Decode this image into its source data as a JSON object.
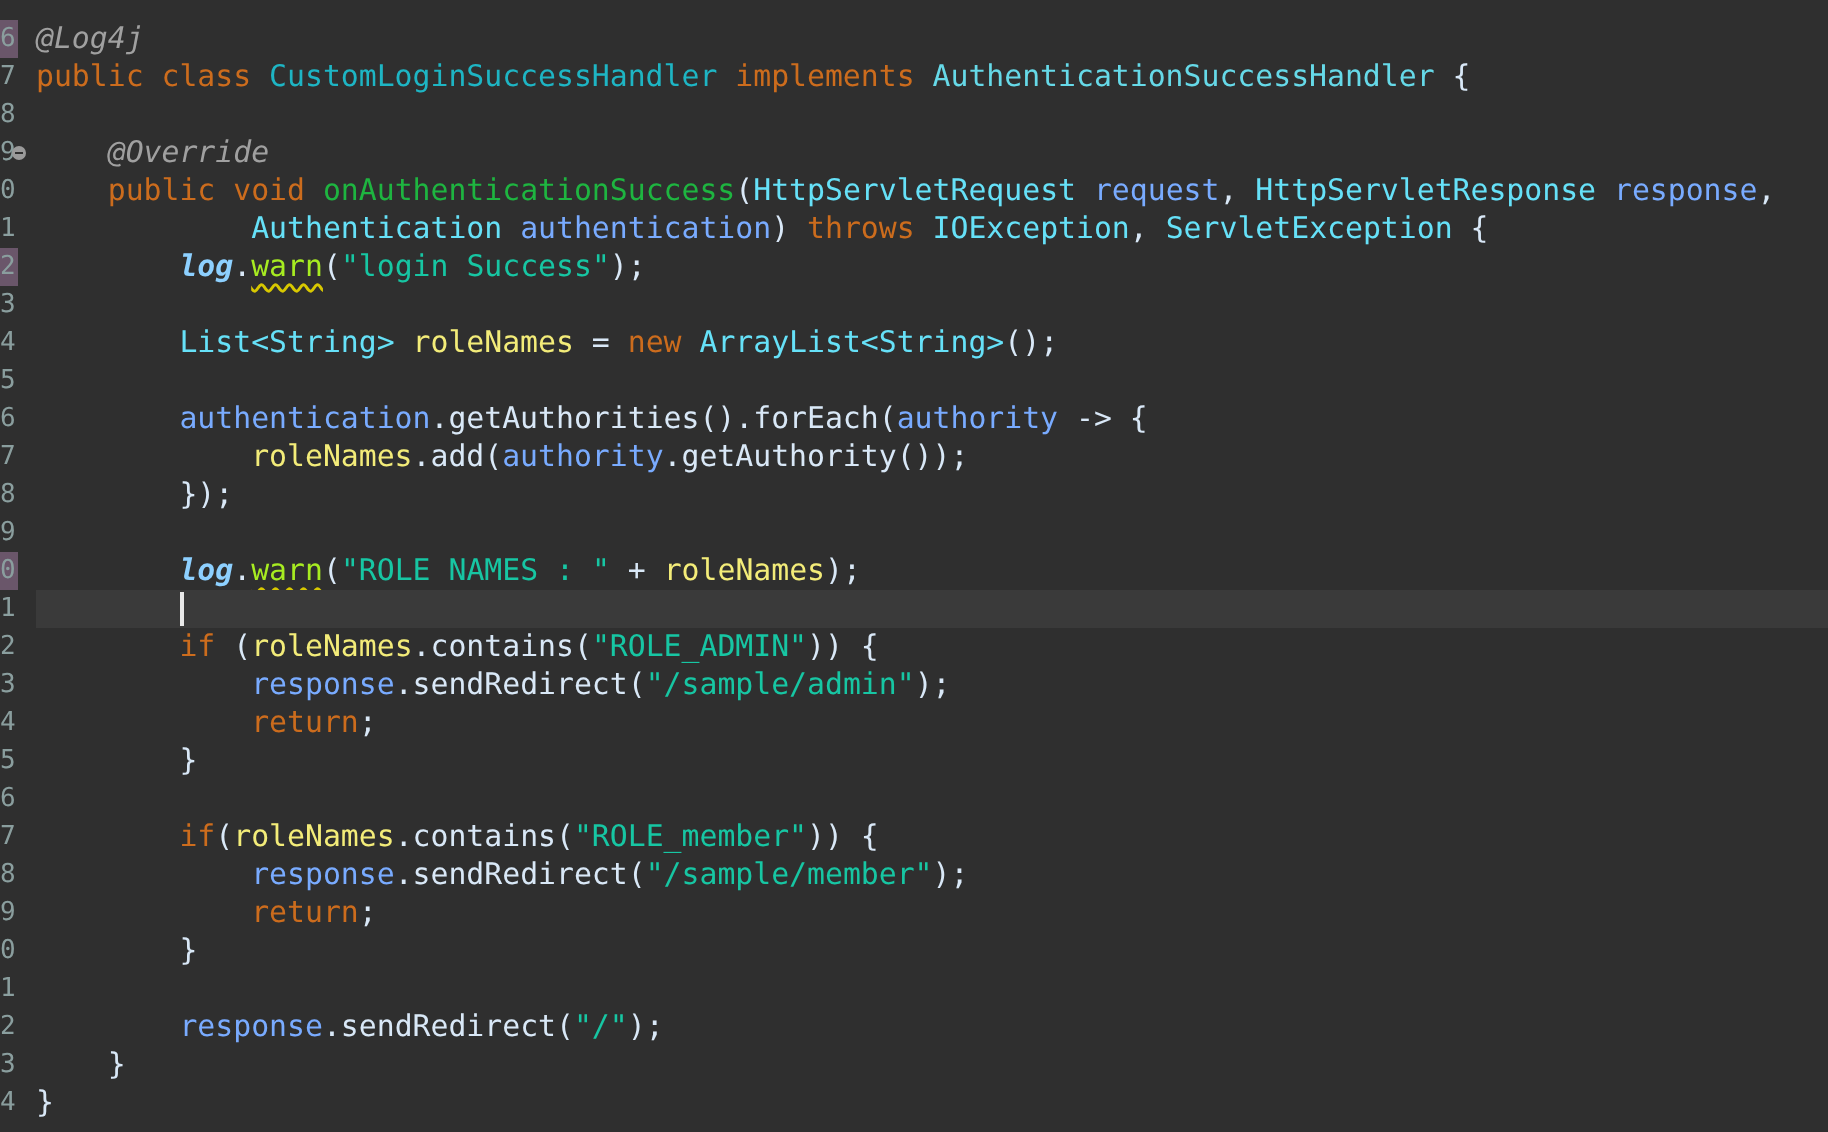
{
  "editor": {
    "lines": [
      {
        "number": "6",
        "marked": true,
        "fold": false,
        "current": false,
        "tokens": [
          {
            "kind": "annotation",
            "text": "@Log4j"
          }
        ]
      },
      {
        "number": "7",
        "marked": false,
        "fold": false,
        "current": false,
        "tokens": [
          {
            "kind": "keyword",
            "text": "public class "
          },
          {
            "kind": "class",
            "text": "CustomLoginSuccessHandler "
          },
          {
            "kind": "keyword",
            "text": "implements "
          },
          {
            "kind": "interface",
            "text": "AuthenticationSuccessHandler"
          },
          {
            "kind": "plain",
            "text": " {"
          }
        ]
      },
      {
        "number": "8",
        "marked": false,
        "fold": false,
        "current": false
      },
      {
        "number": "9",
        "marked": false,
        "fold": true,
        "current": false,
        "tokens": [
          {
            "kind": "annotation",
            "text": "    @Override"
          }
        ]
      },
      {
        "number": "0",
        "marked": false,
        "fold": false,
        "current": false,
        "tokens": [
          {
            "kind": "keyword",
            "text": "    public void "
          },
          {
            "kind": "method",
            "text": "onAuthenticationSuccess"
          },
          {
            "kind": "plain",
            "text": "("
          },
          {
            "kind": "type",
            "text": "HttpServletRequest "
          },
          {
            "kind": "param",
            "text": "request"
          },
          {
            "kind": "plain",
            "text": ", "
          },
          {
            "kind": "type",
            "text": "HttpServletResponse "
          },
          {
            "kind": "param",
            "text": "response"
          },
          {
            "kind": "plain",
            "text": ","
          }
        ]
      },
      {
        "number": "1",
        "marked": false,
        "fold": false,
        "current": false,
        "tokens": [
          {
            "kind": "type",
            "text": "            Authentication "
          },
          {
            "kind": "param",
            "text": "authentication"
          },
          {
            "kind": "plain",
            "text": ") "
          },
          {
            "kind": "keyword",
            "text": "throws "
          },
          {
            "kind": "type",
            "text": "IOException"
          },
          {
            "kind": "plain",
            "text": ", "
          },
          {
            "kind": "type",
            "text": "ServletException"
          },
          {
            "kind": "plain",
            "text": " {"
          }
        ]
      },
      {
        "number": "2",
        "marked": true,
        "fold": false,
        "current": false,
        "tokens": [
          {
            "kind": "static",
            "text": "        log"
          },
          {
            "kind": "plain",
            "text": "."
          },
          {
            "kind": "warning",
            "text": "warn"
          },
          {
            "kind": "plain",
            "text": "("
          },
          {
            "kind": "string",
            "text": "\"login Success\""
          },
          {
            "kind": "plain",
            "text": ");"
          }
        ]
      },
      {
        "number": "3",
        "marked": false,
        "fold": false,
        "current": false
      },
      {
        "number": "4",
        "marked": false,
        "fold": false,
        "current": false,
        "tokens": [
          {
            "kind": "type",
            "text": "        List<String> "
          },
          {
            "kind": "local",
            "text": "roleNames"
          },
          {
            "kind": "plain",
            "text": " = "
          },
          {
            "kind": "keyword",
            "text": "new "
          },
          {
            "kind": "type",
            "text": "ArrayList<String>"
          },
          {
            "kind": "plain",
            "text": "();"
          }
        ]
      },
      {
        "number": "5",
        "marked": false,
        "fold": false,
        "current": false
      },
      {
        "number": "6",
        "marked": false,
        "fold": false,
        "current": false,
        "tokens": [
          {
            "kind": "param",
            "text": "        authentication"
          },
          {
            "kind": "plain",
            "text": ".getAuthorities().forEach("
          },
          {
            "kind": "param",
            "text": "authority"
          },
          {
            "kind": "plain",
            "text": " -> {"
          }
        ]
      },
      {
        "number": "7",
        "marked": false,
        "fold": false,
        "current": false,
        "tokens": [
          {
            "kind": "local",
            "text": "            roleNames"
          },
          {
            "kind": "plain",
            "text": ".add("
          },
          {
            "kind": "param",
            "text": "authority"
          },
          {
            "kind": "plain",
            "text": ".getAuthority());"
          }
        ]
      },
      {
        "number": "8",
        "marked": false,
        "fold": false,
        "current": false,
        "tokens": [
          {
            "kind": "plain",
            "text": "        });"
          }
        ]
      },
      {
        "number": "9",
        "marked": false,
        "fold": false,
        "current": false
      },
      {
        "number": "0",
        "marked": true,
        "fold": false,
        "current": false,
        "tokens": [
          {
            "kind": "static",
            "text": "        log"
          },
          {
            "kind": "plain",
            "text": "."
          },
          {
            "kind": "warning",
            "text": "warn"
          },
          {
            "kind": "plain",
            "text": "("
          },
          {
            "kind": "string",
            "text": "\"ROLE NAMES : \""
          },
          {
            "kind": "plain",
            "text": " + "
          },
          {
            "kind": "local",
            "text": "roleNames"
          },
          {
            "kind": "plain",
            "text": ");"
          }
        ]
      },
      {
        "number": "1",
        "marked": false,
        "fold": false,
        "current": true
      },
      {
        "number": "2",
        "marked": false,
        "fold": false,
        "current": false,
        "tokens": [
          {
            "kind": "keyword",
            "text": "        if"
          },
          {
            "kind": "plain",
            "text": " ("
          },
          {
            "kind": "local",
            "text": "roleNames"
          },
          {
            "kind": "plain",
            "text": ".contains("
          },
          {
            "kind": "string",
            "text": "\"ROLE_ADMIN\""
          },
          {
            "kind": "plain",
            "text": ")) {"
          }
        ]
      },
      {
        "number": "3",
        "marked": false,
        "fold": false,
        "current": false,
        "tokens": [
          {
            "kind": "param",
            "text": "            response"
          },
          {
            "kind": "plain",
            "text": ".sendRedirect("
          },
          {
            "kind": "string",
            "text": "\"/sample/admin\""
          },
          {
            "kind": "plain",
            "text": ");"
          }
        ]
      },
      {
        "number": "4",
        "marked": false,
        "fold": false,
        "current": false,
        "tokens": [
          {
            "kind": "keyword",
            "text": "            return"
          },
          {
            "kind": "plain",
            "text": ";"
          }
        ]
      },
      {
        "number": "5",
        "marked": false,
        "fold": false,
        "current": false,
        "tokens": [
          {
            "kind": "plain",
            "text": "        }"
          }
        ]
      },
      {
        "number": "6",
        "marked": false,
        "fold": false,
        "current": false
      },
      {
        "number": "7",
        "marked": false,
        "fold": false,
        "current": false,
        "tokens": [
          {
            "kind": "keyword",
            "text": "        if"
          },
          {
            "kind": "plain",
            "text": "("
          },
          {
            "kind": "local",
            "text": "roleNames"
          },
          {
            "kind": "plain",
            "text": ".contains("
          },
          {
            "kind": "string",
            "text": "\"ROLE_member\""
          },
          {
            "kind": "plain",
            "text": ")) {"
          }
        ]
      },
      {
        "number": "8",
        "marked": false,
        "fold": false,
        "current": false,
        "tokens": [
          {
            "kind": "param",
            "text": "            response"
          },
          {
            "kind": "plain",
            "text": ".sendRedirect("
          },
          {
            "kind": "string",
            "text": "\"/sample/member\""
          },
          {
            "kind": "plain",
            "text": ");"
          }
        ]
      },
      {
        "number": "9",
        "marked": false,
        "fold": false,
        "current": false,
        "tokens": [
          {
            "kind": "keyword",
            "text": "            return"
          },
          {
            "kind": "plain",
            "text": ";"
          }
        ]
      },
      {
        "number": "0",
        "marked": false,
        "fold": false,
        "current": false,
        "tokens": [
          {
            "kind": "plain",
            "text": "        }"
          }
        ]
      },
      {
        "number": "1",
        "marked": false,
        "fold": false,
        "current": false
      },
      {
        "number": "2",
        "marked": false,
        "fold": false,
        "current": false,
        "tokens": [
          {
            "kind": "param",
            "text": "        response"
          },
          {
            "kind": "plain",
            "text": ".sendRedirect("
          },
          {
            "kind": "string",
            "text": "\"/\""
          },
          {
            "kind": "plain",
            "text": ");"
          }
        ]
      },
      {
        "number": "3",
        "marked": false,
        "fold": false,
        "current": false,
        "tokens": [
          {
            "kind": "plain",
            "text": "    }"
          }
        ]
      },
      {
        "number": "4",
        "marked": false,
        "fold": false,
        "current": false,
        "tokens": [
          {
            "kind": "plain",
            "text": "}"
          }
        ]
      }
    ]
  }
}
